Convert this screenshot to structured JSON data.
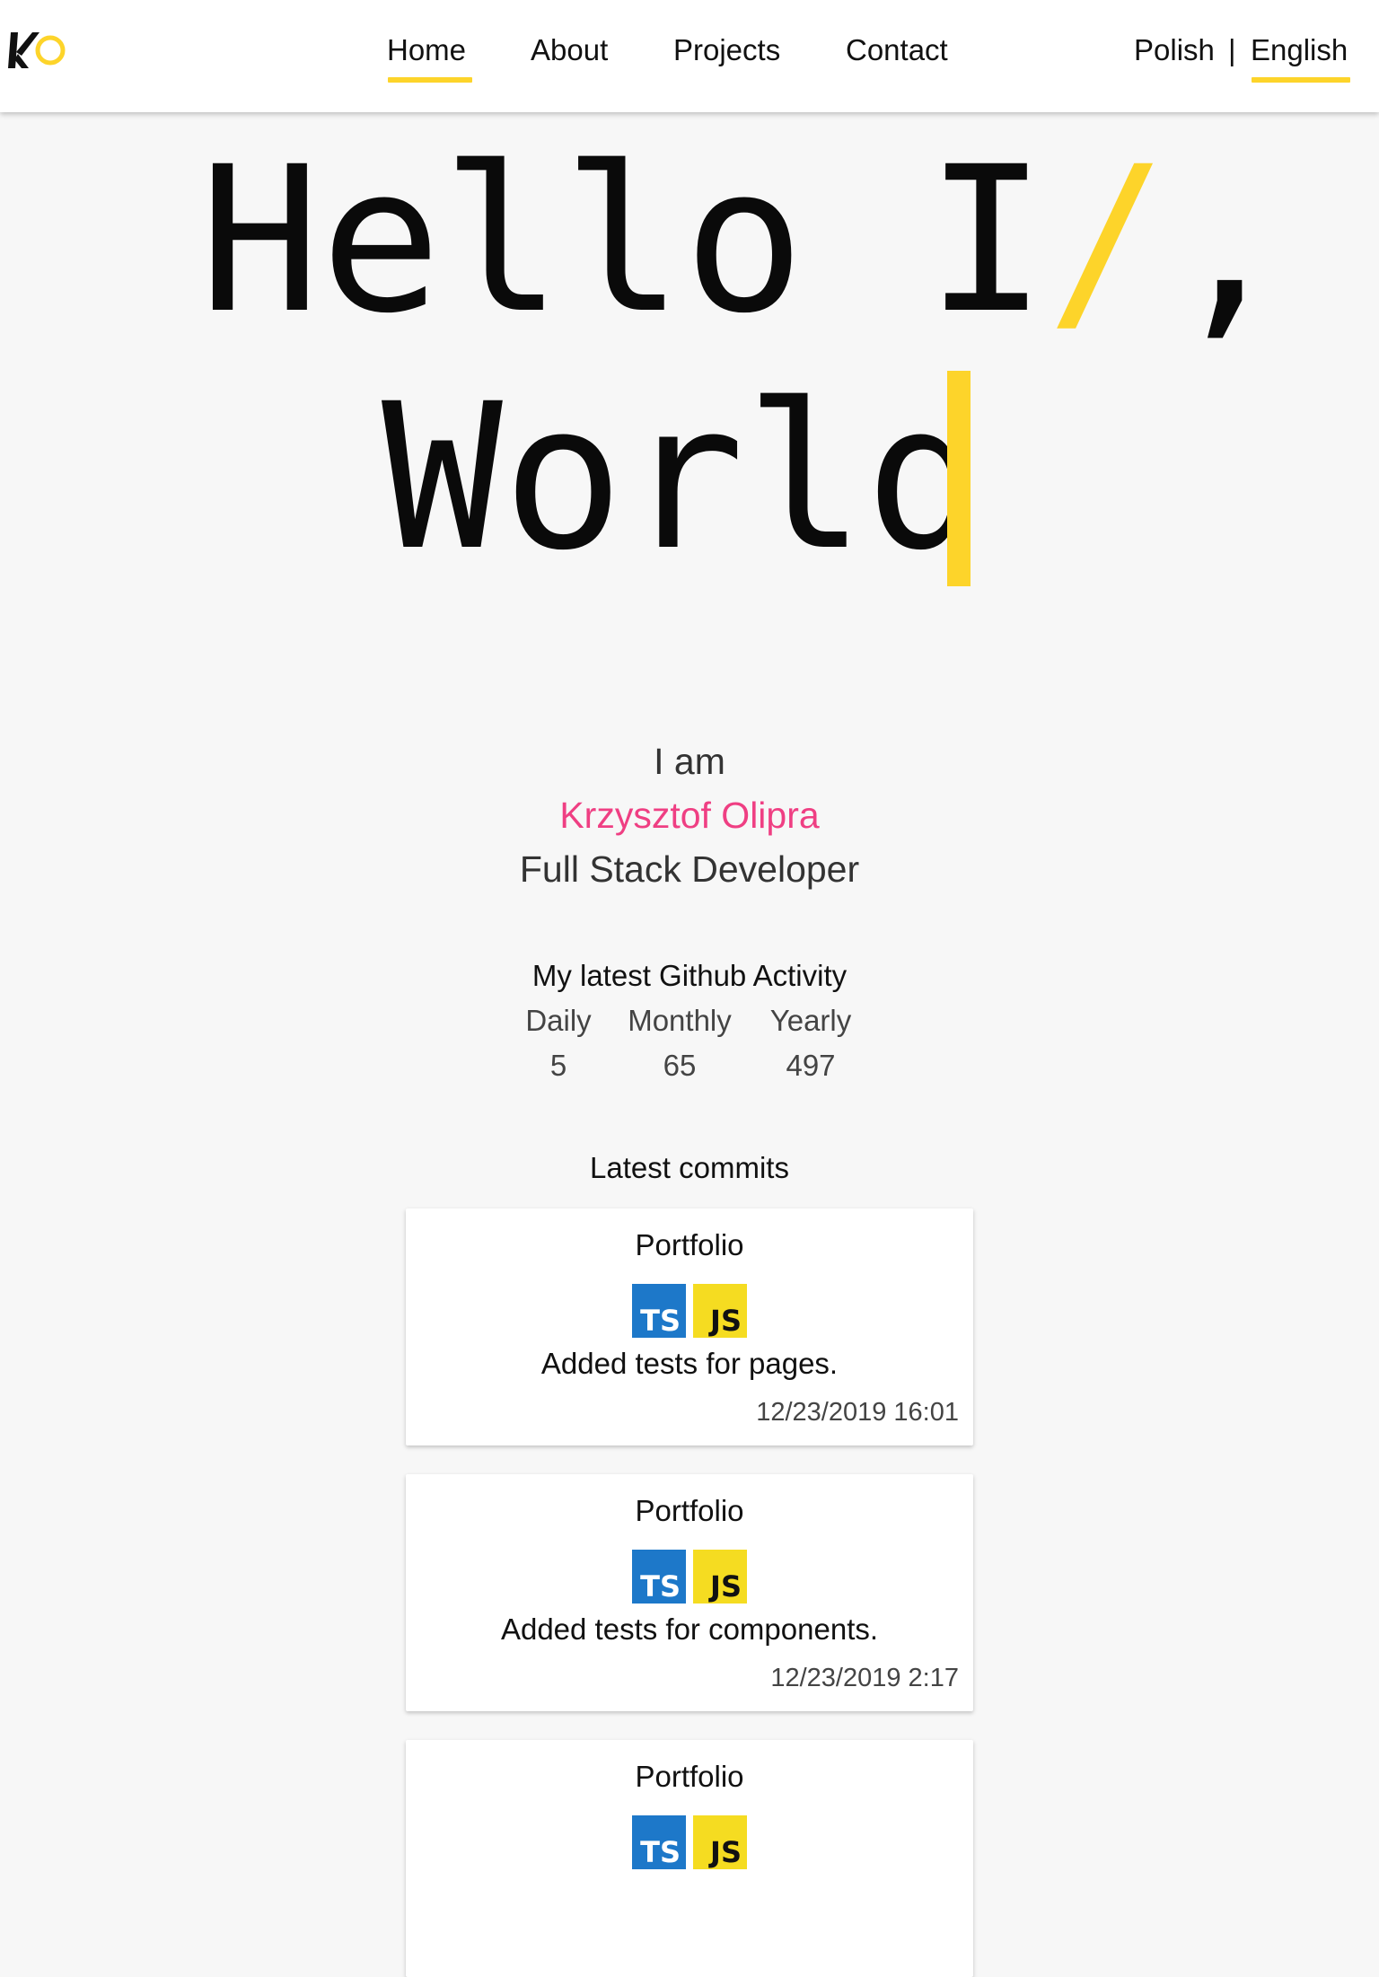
{
  "nav": {
    "logo_text": "KO",
    "links": [
      "Home",
      "About",
      "Projects",
      "Contact"
    ],
    "active_link": "Home",
    "languages": [
      "Polish",
      "English"
    ],
    "language_separator": "|",
    "active_language": "English"
  },
  "hero": {
    "line1_a": "Hello I",
    "line1_slash": "/",
    "line1_b": ",",
    "line2": "World"
  },
  "intro": {
    "iam": "I am",
    "name": "Krzysztof Olipra",
    "role": "Full Stack Developer"
  },
  "github": {
    "title": "My latest Github Activity",
    "stats": [
      {
        "label": "Daily",
        "value": "5"
      },
      {
        "label": "Monthly",
        "value": "65"
      },
      {
        "label": "Yearly",
        "value": "497"
      }
    ]
  },
  "commits": {
    "title": "Latest commits",
    "items": [
      {
        "repo": "Portfolio",
        "badges": [
          "TS",
          "JS"
        ],
        "message": "Added tests for pages.",
        "date": "12/23/2019 16:01"
      },
      {
        "repo": "Portfolio",
        "badges": [
          "TS",
          "JS"
        ],
        "message": "Added tests for components.",
        "date": "12/23/2019 2:17"
      },
      {
        "repo": "Portfolio",
        "badges": [
          "TS",
          "JS"
        ],
        "message": "",
        "date": ""
      }
    ]
  },
  "colors": {
    "accent_yellow": "#fdd42a",
    "name_pink": "#ef3f83",
    "ts_blue": "#1d78c9",
    "js_yellow": "#f5dc21",
    "background": "#f7f7f7"
  }
}
